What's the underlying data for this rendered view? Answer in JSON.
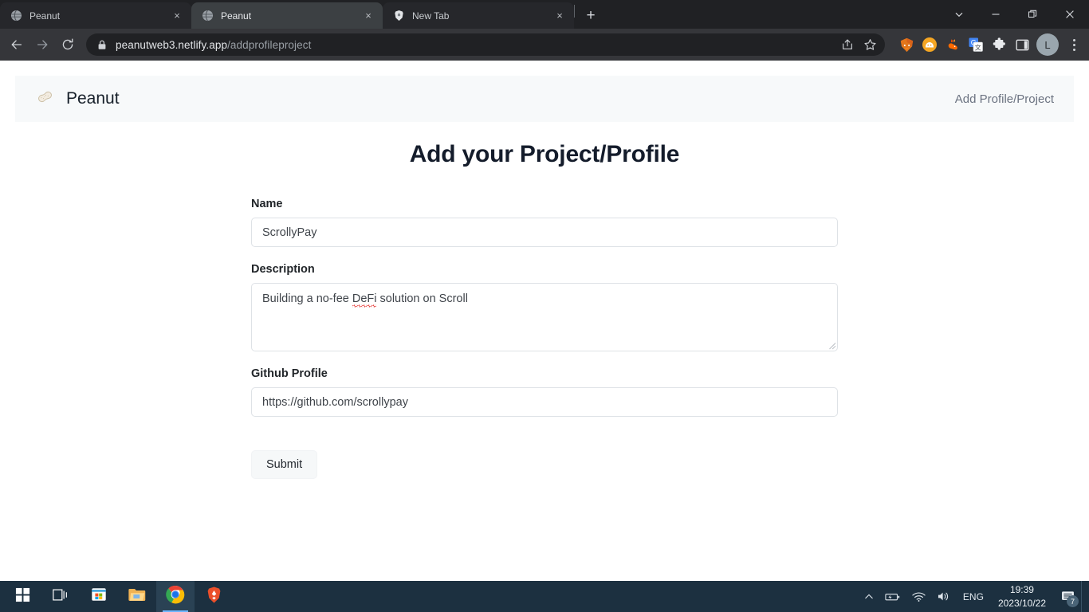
{
  "browser": {
    "tabs": [
      {
        "title": "Peanut",
        "favicon": "globe-icon",
        "active": false,
        "close_label": "×"
      },
      {
        "title": "Peanut",
        "favicon": "globe-icon",
        "active": true,
        "close_label": "×"
      },
      {
        "title": "New Tab",
        "favicon": "brave-icon",
        "active": false,
        "close_label": "×"
      }
    ],
    "new_tab_label": "+",
    "window_controls": {
      "tab_search": "chevron-down-icon",
      "minimize": "minimize-icon",
      "maximize": "maximize-icon",
      "close": "close-icon"
    },
    "toolbar": {
      "back": "back-arrow-icon",
      "forward": "forward-arrow-icon",
      "reload": "reload-icon",
      "lock": "lock-icon",
      "url_domain": "peanutweb3.netlify.app",
      "url_path": "/addprofileproject",
      "share": "share-icon",
      "bookmark": "star-icon",
      "extensions": [
        {
          "name": "metamask-extension-icon"
        },
        {
          "name": "phantom-extension-icon"
        },
        {
          "name": "rabby-extension-icon"
        },
        {
          "name": "google-translate-extension-icon"
        },
        {
          "name": "extensions-puzzle-icon"
        },
        {
          "name": "side-panel-icon"
        }
      ],
      "profile_initial": "L",
      "menu": "three-dot-menu-icon"
    }
  },
  "page": {
    "navbar": {
      "logo": "peanut-logo-icon",
      "brand": "Peanut",
      "link": "Add Profile/Project"
    },
    "title": "Add your Project/Profile",
    "form": {
      "fields": [
        {
          "label": "Name",
          "value": "ScrollyPay",
          "type": "text"
        },
        {
          "label": "Description",
          "value": "Building a no-fee DeFi solution on Scroll",
          "type": "textarea"
        },
        {
          "label": "Github Profile",
          "value": "https://github.com/scrollypay",
          "type": "text"
        }
      ],
      "description_parts": {
        "before": "Building a no-fee ",
        "misspelled": "DeFi",
        "after": " solution on Scroll"
      },
      "submit_label": "Submit"
    }
  },
  "taskbar": {
    "items": [
      {
        "name": "start-button",
        "icon": "windows-logo-icon",
        "active": false
      },
      {
        "name": "task-view-button",
        "icon": "task-view-icon",
        "active": false
      },
      {
        "name": "microsoft-store-button",
        "icon": "microsoft-store-icon",
        "active": false
      },
      {
        "name": "file-explorer-button",
        "icon": "file-explorer-icon",
        "active": false
      },
      {
        "name": "chrome-button",
        "icon": "chrome-icon",
        "active": true
      },
      {
        "name": "brave-button",
        "icon": "brave-icon",
        "active": false
      }
    ],
    "tray": {
      "overflow": "chevron-up-icon",
      "battery": "battery-charging-icon",
      "network": "wifi-icon",
      "volume": "speaker-icon",
      "language": "ENG",
      "time": "19:39",
      "date": "2023/10/22",
      "notifications": "notification-icon",
      "notification_count": "7"
    }
  },
  "colors": {
    "chrome_tabstrip": "#202124",
    "chrome_toolbar": "#35363a",
    "navbar_bg": "#f7f9fa",
    "taskbar_bg": "#1c3040",
    "spellcheck_red": "#e53935"
  }
}
